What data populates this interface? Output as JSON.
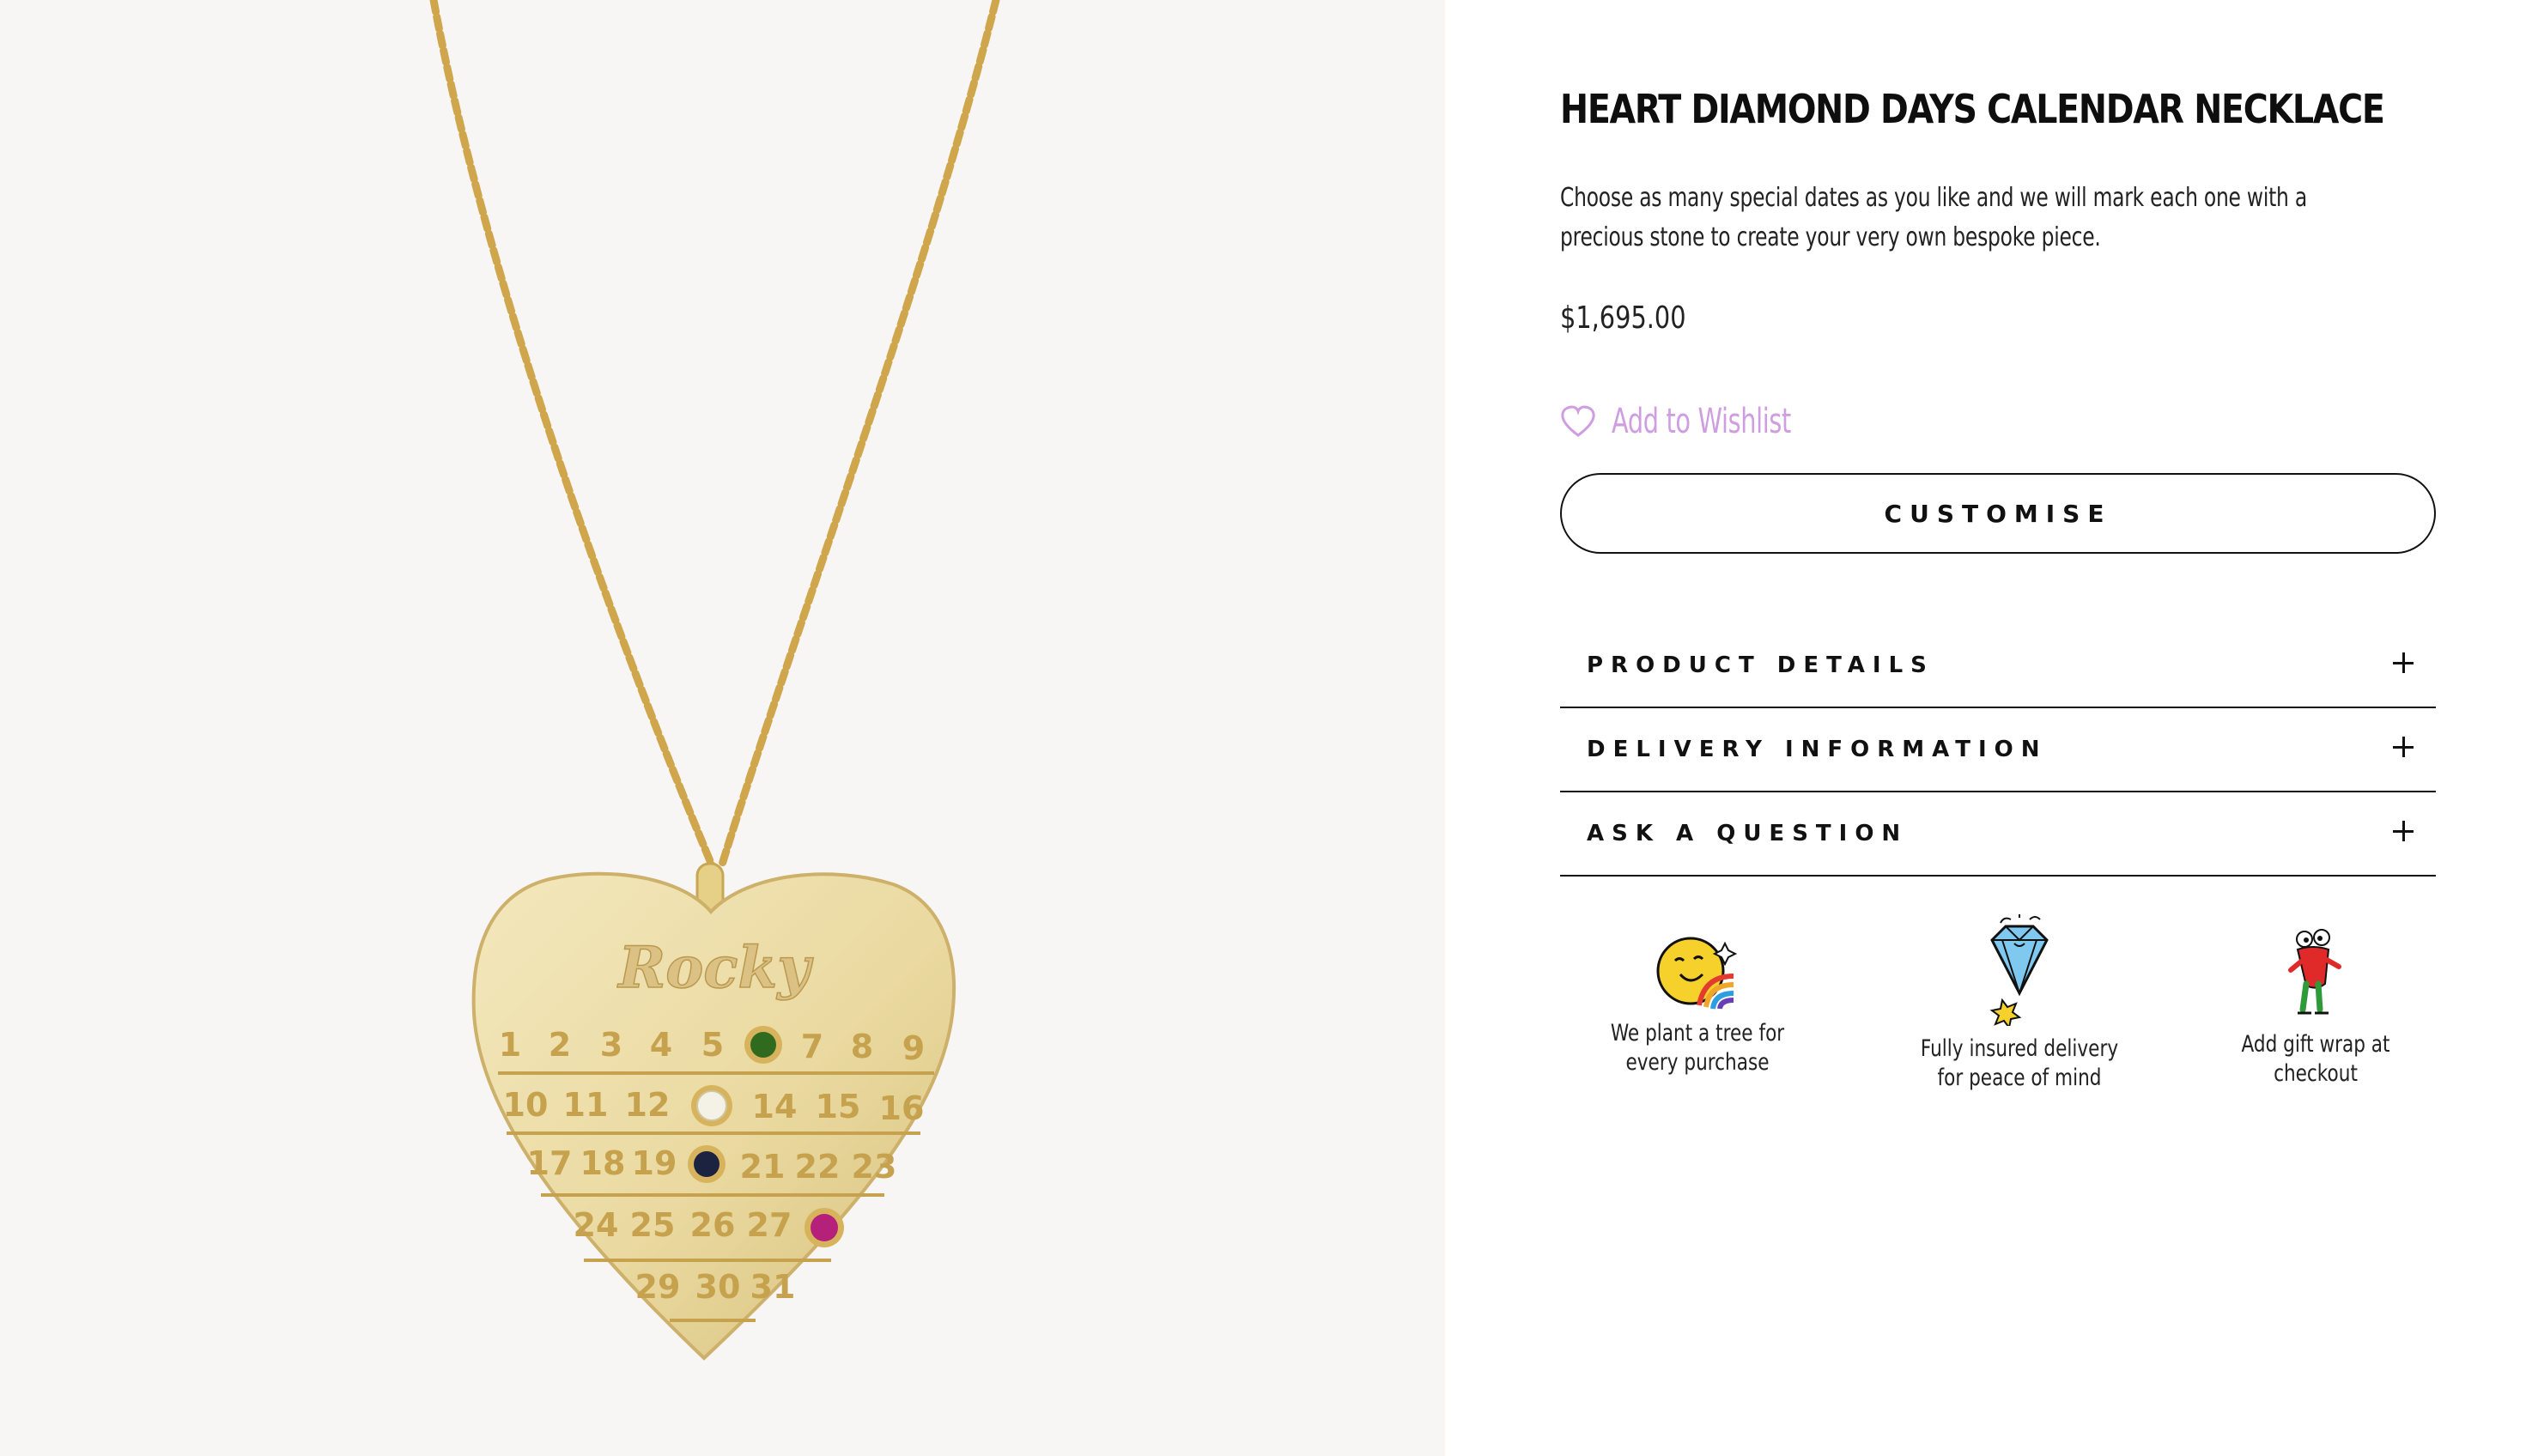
{
  "product": {
    "title": "HEART DIAMOND DAYS CALENDAR NECKLACE",
    "description": "Choose as many special dates as you like and we will mark each one with a precious stone to create your very own bespoke piece.",
    "price": "$1,695.00",
    "wishlist_label": "Add to Wishlist",
    "customise_label": "CUSTOMISE"
  },
  "pendant": {
    "name": "Rocky",
    "rows": [
      [
        "1",
        "2",
        "3",
        "4",
        "5",
        "",
        "7",
        "8",
        "9"
      ],
      [
        "10",
        "11",
        "12",
        "",
        "14",
        "15",
        "16"
      ],
      [
        "17",
        "18",
        "19",
        "",
        "21",
        "22",
        "23"
      ],
      [
        "24",
        "25",
        "26",
        "27",
        ""
      ],
      [
        "29",
        "30",
        "31"
      ]
    ]
  },
  "accordion": [
    {
      "label": "PRODUCT DETAILS"
    },
    {
      "label": "DELIVERY INFORMATION"
    },
    {
      "label": "ASK A QUESTION"
    }
  ],
  "perks": [
    {
      "icon": "planet-rainbow-icon",
      "label": "We plant a tree for every purchase"
    },
    {
      "icon": "diamond-icon",
      "label": "Fully insured delivery for peace of mind"
    },
    {
      "icon": "gift-character-icon",
      "label": "Add gift wrap at checkout"
    }
  ],
  "colors": {
    "gold": "#e9d9a1",
    "wishlist_accent": "#cf9ee0",
    "image_background": "#f8f6f4",
    "stone_green": "#2f6a1e",
    "stone_white": "#f4f1e6",
    "stone_blue": "#1b2340",
    "stone_pink": "#b4207a"
  }
}
